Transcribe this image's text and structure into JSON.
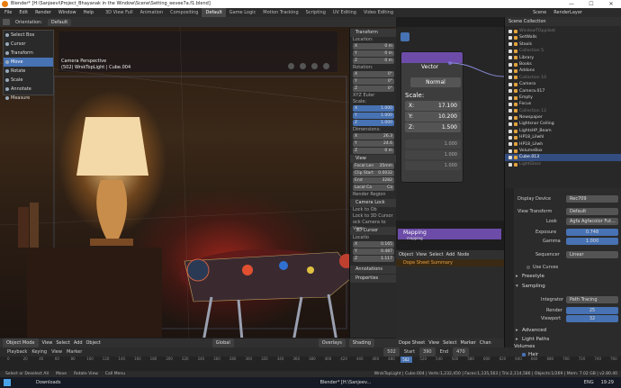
{
  "titlebar": {
    "title": "Blender* [H:\\Sanjeevi\\Project_Bhayanak in the Window\\Scene\\Setting_eevee7a.f1.blend]",
    "min": "—",
    "max": "☐",
    "close": "✕"
  },
  "menu": {
    "items": [
      "File",
      "Edit",
      "Render",
      "Window",
      "Help"
    ],
    "workspaces": [
      "3D View Full",
      "Animation",
      "Compositing",
      "Default",
      "Game Logic",
      "Motion Tracking",
      "Scripting",
      "UV Editing",
      "Video Editing"
    ],
    "active_workspace": "Default",
    "scene": "Scene",
    "render_layer": "RenderLayer"
  },
  "viewport_header": {
    "orientation_label": "Orientation:",
    "orientation": "Default"
  },
  "tools": [
    "Select Box",
    "Cursor",
    "Transform",
    "Move",
    "Rotate",
    "Scale",
    "Annotate",
    "Measure"
  ],
  "active_tool": "Move",
  "viewport": {
    "camera": "Camera Perspective",
    "object": "(502) WrskTopLight | Cube.004"
  },
  "npanel": {
    "transform": "Transform",
    "location": "Location:",
    "loc": [
      [
        "X",
        "0 m"
      ],
      [
        "Y",
        "0 m"
      ],
      [
        "Z",
        "0 m"
      ]
    ],
    "rotation": "Rotation:",
    "rot": [
      [
        "X",
        "0°"
      ],
      [
        "Y",
        "0°"
      ],
      [
        "Z",
        "0°"
      ]
    ],
    "euler": "XYZ Euler",
    "scale": "Scale:",
    "scl": [
      [
        "X",
        "1.000"
      ],
      [
        "Y",
        "1.000"
      ],
      [
        "Z",
        "1.000"
      ]
    ],
    "dimensions": "Dimensions:",
    "dim": [
      [
        "X",
        "26.3"
      ],
      [
        "Y",
        "24.6"
      ],
      [
        "Z",
        "0 m"
      ]
    ],
    "view": "View",
    "focal": "Focal Len",
    "focal_val": "35mm",
    "clip_start": "Clip Start",
    "clip_start_val": "0.0032",
    "clip_end": "End",
    "clip_end_val": "3282",
    "local_cam": "Local Ca",
    "local_cam_val": "Ca",
    "render_region": "Render Region",
    "camera_lock": "Camera Lock",
    "lock_to": "Lock to Ob",
    "lock_3d": "Lock to 3D Cursor",
    "lock_cam": "ock Camera to View",
    "cursor": "3D Cursor",
    "cursor_loc": "Locatio",
    "cur": [
      [
        "X",
        "0.165"
      ],
      [
        "Y",
        "0.487"
      ],
      [
        "Z",
        "1.117"
      ]
    ],
    "annotations": "Annotations",
    "properties": "Properties"
  },
  "node": {
    "title": "Vector",
    "mode": "Normal",
    "scale": "Scale:",
    "fields": [
      [
        "X:",
        "17.100"
      ],
      [
        "Y:",
        "10.200"
      ],
      [
        "Z:",
        "1.500"
      ]
    ],
    "dims": [
      "1.000",
      "1.000",
      "1.000"
    ],
    "mapping": "Mapping",
    "mapping_sub": "mapping"
  },
  "dope": {
    "menu": [
      "Object",
      "View",
      "Select",
      "Add",
      "Node"
    ],
    "summary": "Dope Sheet Summary",
    "footer": [
      "Dope Sheet",
      "View",
      "Select",
      "Marker",
      "Chan"
    ]
  },
  "vp_footer": {
    "mode": "Object Mode",
    "menus": [
      "View",
      "Select",
      "Add",
      "Object"
    ],
    "pivot": "Global",
    "overlays": "Overlays",
    "shading": "Shading"
  },
  "timeline_hdr": {
    "items": [
      "Playback",
      "Keying",
      "View",
      "Marker"
    ],
    "frame": "502",
    "start_label": "Start",
    "start": "390",
    "end_label": "End",
    "end": "470"
  },
  "timeline": {
    "ticks": [
      "0",
      "20",
      "40",
      "60",
      "80",
      "100",
      "120",
      "140",
      "160",
      "180",
      "200",
      "220",
      "240",
      "260",
      "280",
      "300",
      "320",
      "340",
      "360",
      "380",
      "400",
      "420",
      "440",
      "460",
      "480",
      "500",
      "520",
      "540",
      "560",
      "580",
      "600",
      "620",
      "640",
      "660",
      "680",
      "700",
      "720",
      "740",
      "760"
    ],
    "current": "502",
    "current_val": 502,
    "range_max": 760
  },
  "status": {
    "left": [
      "Select or Deselect All",
      "Move",
      "Rotate View",
      "Call Menu"
    ],
    "right": "WrskTopLight | Cube.004 | Verts:1,232,450 | Faces:1,135,563 | Tris:2,114,586 | Objects:1/269 | Mem: 7.02 GB | v2.80.40"
  },
  "outliner": {
    "title": "Scene Collection",
    "items": [
      {
        "t": "WindowTOppilast",
        "d": 1
      },
      {
        "t": "SetWalls",
        "d": 0
      },
      {
        "t": "Stools",
        "d": 0
      },
      {
        "t": "Collection 5",
        "d": 1
      },
      {
        "t": "Library",
        "d": 0
      },
      {
        "t": "Books",
        "d": 0
      },
      {
        "t": "Addons",
        "d": 0
      },
      {
        "t": "Collection 10",
        "d": 1
      },
      {
        "t": "Camera",
        "d": 0
      },
      {
        "t": "Camera.017",
        "d": 0
      },
      {
        "t": "Empty",
        "d": 0
      },
      {
        "t": "Focus",
        "d": 0
      },
      {
        "t": "Collection 12",
        "d": 1
      },
      {
        "t": "Newspaper",
        "d": 0
      },
      {
        "t": "Lightsnor Ceiling",
        "d": 0
      },
      {
        "t": "LightsHP_Beam",
        "d": 0
      },
      {
        "t": "HP18_Lilwhl",
        "d": 0
      },
      {
        "t": "HP18_Lilwh",
        "d": 0
      },
      {
        "t": "VolumeBox",
        "d": 0
      },
      {
        "t": "Cube.013",
        "d": 0,
        "sel": 1
      },
      {
        "t": "LightGlass",
        "d": 1
      }
    ]
  },
  "props": {
    "display_device_label": "Display Device",
    "display_device": "Rec709",
    "view_transform_label": "View Transform",
    "view_transform": "Default",
    "look_label": "Look",
    "look": "Agfa Agfacolor Fut...",
    "exposure_label": "Exposure",
    "exposure": "0.748",
    "gamma_label": "Gamma",
    "gamma": "1.000",
    "sequencer_label": "Sequencer",
    "sequencer": "Linear",
    "use_curves": "Use Curves",
    "freestyle": "Freestyle",
    "sampling": "Sampling",
    "integrator_label": "Integrator",
    "integrator": "Path Tracing",
    "render_label": "Render",
    "render": "25",
    "viewport_label": "Viewport",
    "viewport": "32",
    "advanced": "Advanced",
    "light_paths": "Light Paths",
    "volumes": "Volumes",
    "hair": "Hair"
  },
  "taskbar": {
    "items": [
      "Downloads",
      "Blender* [H:\\Sanjeev..."
    ],
    "lang": "ENG",
    "time": "19:29"
  }
}
